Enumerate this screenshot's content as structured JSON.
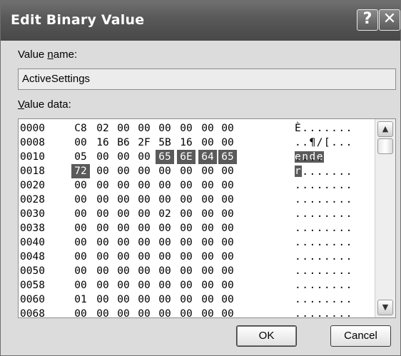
{
  "dialog": {
    "title": "Edit Binary Value",
    "help_glyph": "?",
    "close_glyph": "✕"
  },
  "value_name": {
    "label_pre": "Value ",
    "label_accel": "n",
    "label_post": "ame:",
    "value": "ActiveSettings"
  },
  "value_data": {
    "label_accel": "V",
    "label_post": "alue data:",
    "rows": [
      {
        "addr": "0000",
        "bytes": [
          "C8",
          "02",
          "00",
          "00",
          "00",
          "00",
          "00",
          "00"
        ],
        "ascii": "È......."
      },
      {
        "addr": "0008",
        "bytes": [
          "00",
          "16",
          "B6",
          "2F",
          "5B",
          "16",
          "00",
          "00"
        ],
        "ascii": "..¶/[..."
      },
      {
        "addr": "0010",
        "bytes": [
          "05",
          "00",
          "00",
          "00",
          "65",
          "6E",
          "64",
          "65"
        ],
        "ascii_plain": "....",
        "ascii_sel": "ende"
      },
      {
        "addr": "0018",
        "bytes": [
          "72",
          "00",
          "00",
          "00",
          "00",
          "00",
          "00",
          "00"
        ],
        "ascii_sel": "r",
        "ascii_plain": "......."
      },
      {
        "addr": "0020",
        "bytes": [
          "00",
          "00",
          "00",
          "00",
          "00",
          "00",
          "00",
          "00"
        ],
        "ascii": "........"
      },
      {
        "addr": "0028",
        "bytes": [
          "00",
          "00",
          "00",
          "00",
          "00",
          "00",
          "00",
          "00"
        ],
        "ascii": "........"
      },
      {
        "addr": "0030",
        "bytes": [
          "00",
          "00",
          "00",
          "00",
          "02",
          "00",
          "00",
          "00"
        ],
        "ascii": "........"
      },
      {
        "addr": "0038",
        "bytes": [
          "00",
          "00",
          "00",
          "00",
          "00",
          "00",
          "00",
          "00"
        ],
        "ascii": "........"
      },
      {
        "addr": "0040",
        "bytes": [
          "00",
          "00",
          "00",
          "00",
          "00",
          "00",
          "00",
          "00"
        ],
        "ascii": "........"
      },
      {
        "addr": "0048",
        "bytes": [
          "00",
          "00",
          "00",
          "00",
          "00",
          "00",
          "00",
          "00"
        ],
        "ascii": "........"
      },
      {
        "addr": "0050",
        "bytes": [
          "00",
          "00",
          "00",
          "00",
          "00",
          "00",
          "00",
          "00"
        ],
        "ascii": "........"
      },
      {
        "addr": "0058",
        "bytes": [
          "00",
          "00",
          "00",
          "00",
          "00",
          "00",
          "00",
          "00"
        ],
        "ascii": "........"
      },
      {
        "addr": "0060",
        "bytes": [
          "01",
          "00",
          "00",
          "00",
          "00",
          "00",
          "00",
          "00"
        ],
        "ascii": "........"
      },
      {
        "addr": "0068",
        "bytes": [
          "00",
          "00",
          "00",
          "00",
          "00",
          "00",
          "00",
          "00"
        ],
        "ascii": "........"
      }
    ]
  },
  "scrollbar": {
    "up_glyph": "▲",
    "down_glyph": "▼"
  },
  "buttons": {
    "ok": "OK",
    "cancel": "Cancel"
  }
}
